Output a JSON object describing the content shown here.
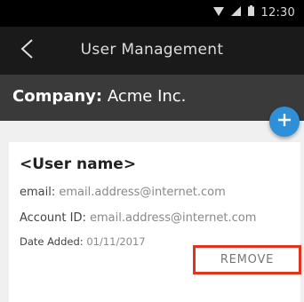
{
  "status_bar": {
    "time": "12:30",
    "icons": [
      "wifi-icon",
      "signal-icon",
      "battery-icon"
    ]
  },
  "toolbar": {
    "title": "User Management",
    "back_icon": "back-chevron-icon"
  },
  "company": {
    "label": "Company:",
    "value": "Acme Inc."
  },
  "fab": {
    "icon": "plus-icon",
    "color": "#2f8fd9"
  },
  "user_card": {
    "name": "<User name>",
    "email_label": "email:",
    "email_value": "email.address@internet.com",
    "account_label": "Account ID:",
    "account_value": "email.address@internet.com",
    "date_label": "Date Added:",
    "date_value": "01/11/2017",
    "remove_label": "REMOVE",
    "remove_highlight_color": "#e2331f"
  }
}
